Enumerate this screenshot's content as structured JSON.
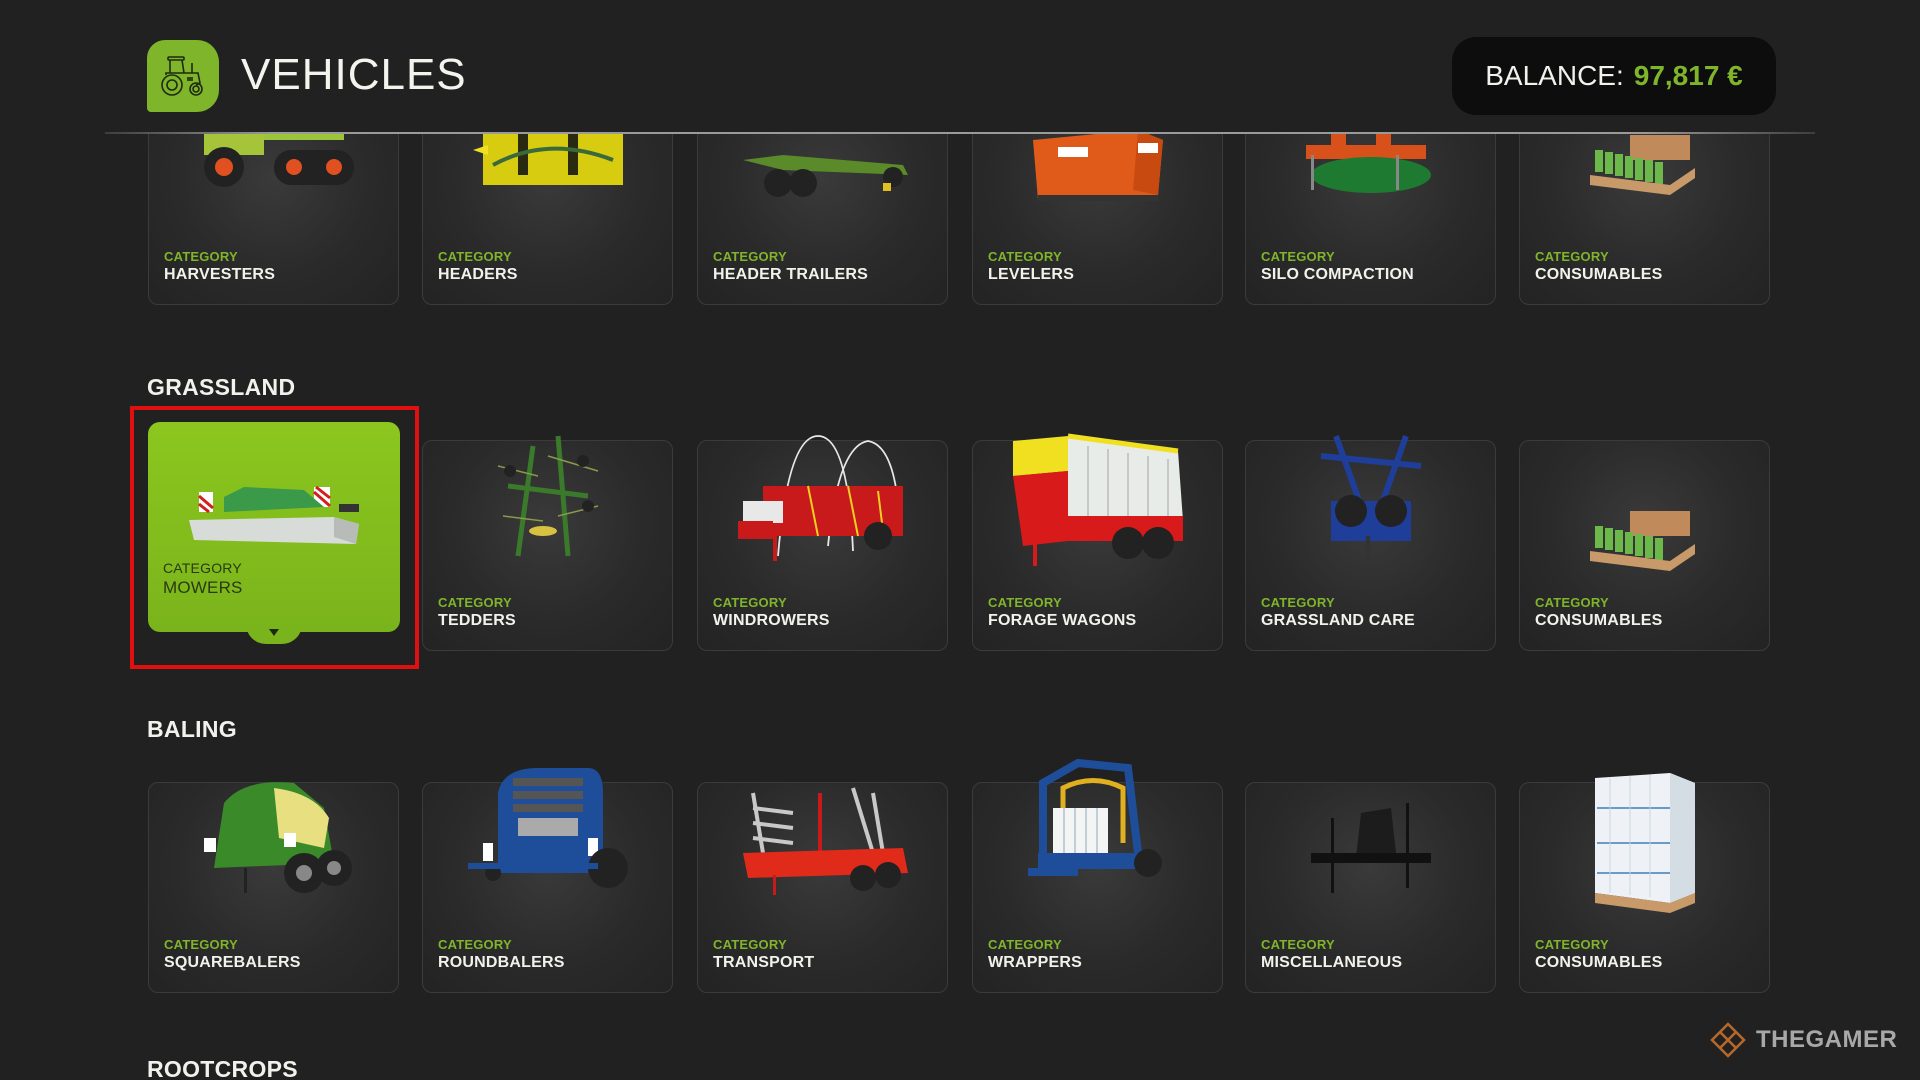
{
  "header": {
    "title": "VEHICLES",
    "icon": "tractor-icon",
    "balance_label": "BALANCE:",
    "balance_value": "97,817 €"
  },
  "colors": {
    "accent": "#7fb52a",
    "background": "#212121",
    "selection_outline": "#e01010"
  },
  "sections": [
    {
      "title": "",
      "items": [
        {
          "category_label": "CATEGORY",
          "name": "HARVESTERS",
          "image": "harvester"
        },
        {
          "category_label": "CATEGORY",
          "name": "HEADERS",
          "image": "header"
        },
        {
          "category_label": "CATEGORY",
          "name": "HEADER TRAILERS",
          "image": "header-trailer"
        },
        {
          "category_label": "CATEGORY",
          "name": "LEVELERS",
          "image": "leveler"
        },
        {
          "category_label": "CATEGORY",
          "name": "SILO COMPACTION",
          "image": "silo-compactor"
        },
        {
          "category_label": "CATEGORY",
          "name": "CONSUMABLES",
          "image": "pallet-bottles"
        }
      ]
    },
    {
      "title": "GRASSLAND",
      "items": [
        {
          "category_label": "CATEGORY",
          "name": "MOWERS",
          "image": "mower",
          "selected": true
        },
        {
          "category_label": "CATEGORY",
          "name": "TEDDERS",
          "image": "tedder"
        },
        {
          "category_label": "CATEGORY",
          "name": "WINDROWERS",
          "image": "windrower"
        },
        {
          "category_label": "CATEGORY",
          "name": "FORAGE WAGONS",
          "image": "forage-wagon"
        },
        {
          "category_label": "CATEGORY",
          "name": "GRASSLAND CARE",
          "image": "grassland-care"
        },
        {
          "category_label": "CATEGORY",
          "name": "CONSUMABLES",
          "image": "pallet-bottles"
        }
      ]
    },
    {
      "title": "BALING",
      "items": [
        {
          "category_label": "CATEGORY",
          "name": "SQUAREBALERS",
          "image": "squarebaler"
        },
        {
          "category_label": "CATEGORY",
          "name": "ROUNDBALERS",
          "image": "roundbaler"
        },
        {
          "category_label": "CATEGORY",
          "name": "TRANSPORT",
          "image": "bale-trailer"
        },
        {
          "category_label": "CATEGORY",
          "name": "WRAPPERS",
          "image": "wrapper"
        },
        {
          "category_label": "CATEGORY",
          "name": "MISCELLANEOUS",
          "image": "bale-fork"
        },
        {
          "category_label": "CATEGORY",
          "name": "CONSUMABLES",
          "image": "pallet-wrap"
        }
      ]
    },
    {
      "title": "ROOTCROPS",
      "items": []
    }
  ],
  "watermark": "THEGAMER"
}
